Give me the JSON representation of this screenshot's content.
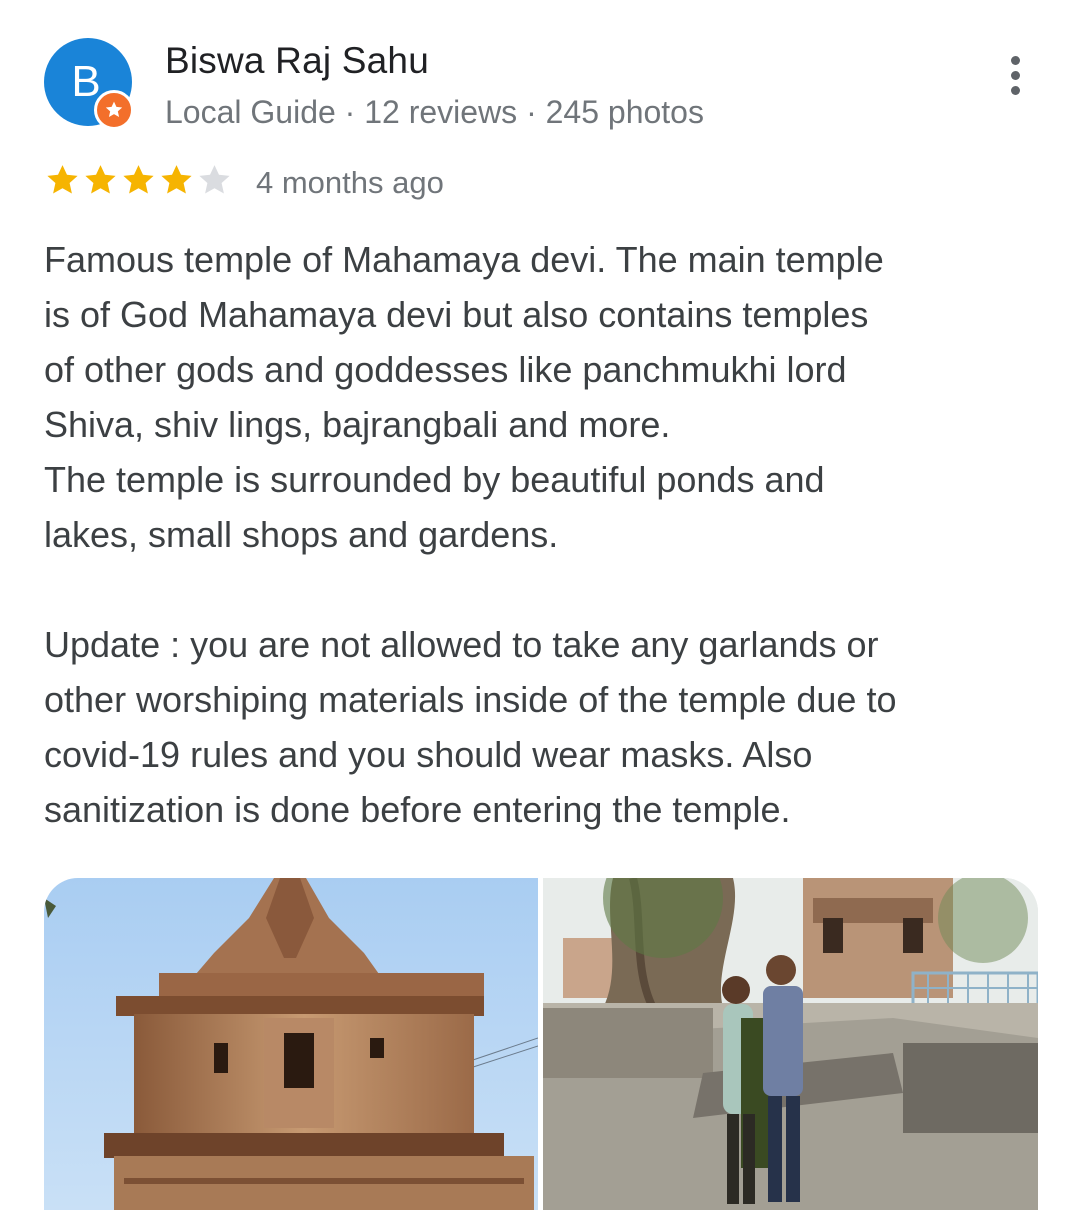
{
  "reviewer": {
    "initial": "B",
    "name": "Biswa Raj Sahu",
    "meta": "Local Guide · 12 reviews · 245 photos"
  },
  "review": {
    "rating": 4,
    "max_rating": 5,
    "age": "4 months ago",
    "text": "Famous temple of Mahamaya devi. The main temple\nis of God Mahamaya devi but also contains temples\nof other gods and goddesses like panchmukhi lord\nShiva, shiv lings, bajrangbali and more.\nThe temple is surrounded by beautiful ponds and\nlakes, small shops and gardens.\n\nUpdate : you are not allowed to take any garlands or\nother worshiping materials inside of the temple due to\ncovid-19 rules and you should wear masks. Also\nsanitization is done before entering the temple."
  },
  "photos": [
    {
      "icon": "temple-photo"
    },
    {
      "icon": "couple-at-temple-photo"
    }
  ],
  "colors": {
    "avatar": "#1a84d8",
    "badge": "#f36f2b",
    "star_filled": "#f6b401",
    "star_empty": "#dadce0",
    "secondary_text": "#70757a"
  }
}
